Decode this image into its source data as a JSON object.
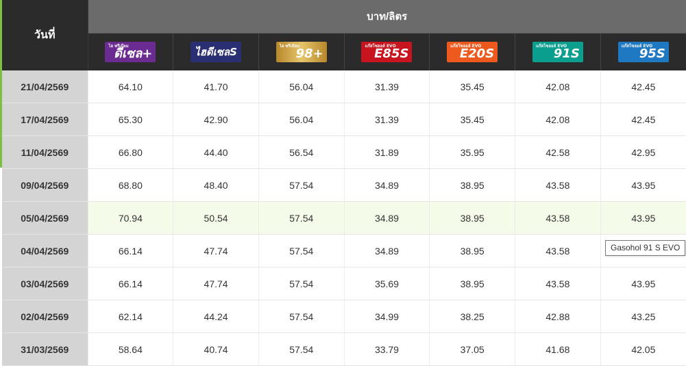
{
  "header": {
    "date_label": "วันที่",
    "unit_label": "บาท/ลิตร"
  },
  "products": [
    {
      "icon": "hi-premium-diesel-plus-logo-icon",
      "small": "ไฮ พรีเมียม",
      "big": "ดีเซล+",
      "color": "#6b2c91"
    },
    {
      "icon": "hi-diesel-s-logo-icon",
      "mid": "ไฮดีเซลS",
      "color": "#2a2e73"
    },
    {
      "icon": "hi-premium-98-plus-logo-icon",
      "small": "ไฮ พรีเมียม",
      "big": "98+",
      "color": "#c9a04a"
    },
    {
      "icon": "gasohol-e85-s-evo-logo-icon",
      "small": "แก๊สโซฮอล์ EVO",
      "big": "E85S",
      "color": "#c8141e"
    },
    {
      "icon": "gasohol-e20-s-evo-logo-icon",
      "small": "แก๊สโซฮอล์ EVO",
      "big": "E20S",
      "color": "#ee5a1e"
    },
    {
      "icon": "gasohol-91-s-evo-logo-icon",
      "small": "แก๊สโซฮอล์ EVO",
      "big": "91S",
      "color": "#0a9e8e"
    },
    {
      "icon": "gasohol-95-s-evo-logo-icon",
      "small": "แก๊สโซฮอล์ EVO",
      "big": "95S",
      "color": "#1f78c2"
    }
  ],
  "rows": [
    {
      "date": "21/04/2569",
      "prices": [
        "64.10",
        "41.70",
        "56.04",
        "31.39",
        "35.45",
        "42.08",
        "42.45"
      ]
    },
    {
      "date": "17/04/2569",
      "prices": [
        "65.30",
        "42.90",
        "56.04",
        "31.39",
        "35.45",
        "42.08",
        "42.45"
      ]
    },
    {
      "date": "11/04/2569",
      "prices": [
        "66.80",
        "44.40",
        "56.54",
        "31.89",
        "35.95",
        "42.58",
        "42.95"
      ]
    },
    {
      "date": "09/04/2569",
      "prices": [
        "68.80",
        "48.40",
        "57.54",
        "34.89",
        "38.95",
        "43.58",
        "43.95"
      ]
    },
    {
      "date": "05/04/2569",
      "prices": [
        "70.94",
        "50.54",
        "57.54",
        "34.89",
        "38.95",
        "43.58",
        "43.95"
      ]
    },
    {
      "date": "04/04/2569",
      "prices": [
        "66.14",
        "47.74",
        "57.54",
        "34.89",
        "38.95",
        "43.58",
        ""
      ]
    },
    {
      "date": "03/04/2569",
      "prices": [
        "66.14",
        "47.74",
        "57.54",
        "35.69",
        "38.95",
        "43.58",
        "43.95"
      ]
    },
    {
      "date": "02/04/2569",
      "prices": [
        "62.14",
        "44.24",
        "57.54",
        "34.99",
        "38.25",
        "42.88",
        "43.25"
      ]
    },
    {
      "date": "31/03/2569",
      "prices": [
        "58.64",
        "40.74",
        "57.54",
        "33.79",
        "37.05",
        "41.68",
        "42.05"
      ]
    }
  ],
  "highlight_row_index": 4,
  "tooltip": {
    "text": "Gasohol 91 S EVO"
  },
  "colors": {
    "header_dark": "#2b2b2b",
    "header_unit": "#6b6b6b",
    "date_column": "#d4d4d4",
    "highlight_row": "#f4fbe9",
    "accent_green": "#7ac142"
  }
}
